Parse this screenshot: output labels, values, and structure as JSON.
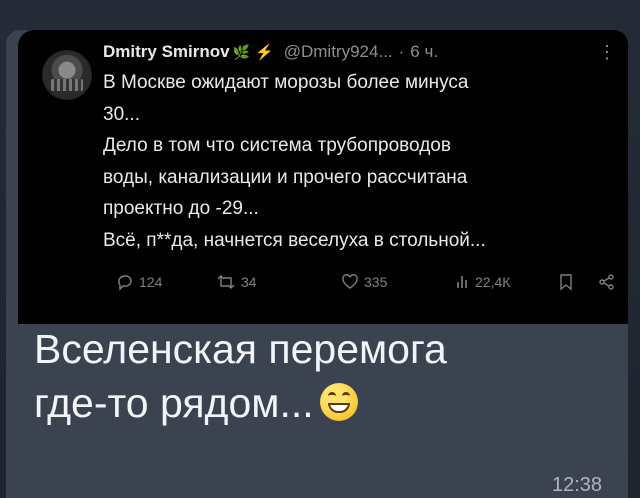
{
  "tweet": {
    "author_name": "Dmitry Smirnov",
    "handle": "@Dmitry924...",
    "separator": "·",
    "time": "6 ч.",
    "more": "⋮",
    "emoji_badge": "🌿",
    "bolt": "⚡",
    "text_lines": [
      "В Москве ожидают морозы более минуса",
      "30...",
      "Дело в том что система трубопроводов",
      "воды, канализации и прочего рассчитана",
      "проектно до -29...",
      "Всё, п**да, начнется веселуха в стольной..."
    ],
    "actions": {
      "replies": "124",
      "retweets": "34",
      "likes": "335",
      "views": "22,4К"
    }
  },
  "message": {
    "lines": [
      "Вселенская перемога",
      "где-то рядом..."
    ],
    "emoji": "😁",
    "time": "12:38"
  },
  "colors": {
    "tweet_bg": "#000000",
    "bubble_bg": "#3b4350",
    "chat_bg": "#1f2630"
  }
}
